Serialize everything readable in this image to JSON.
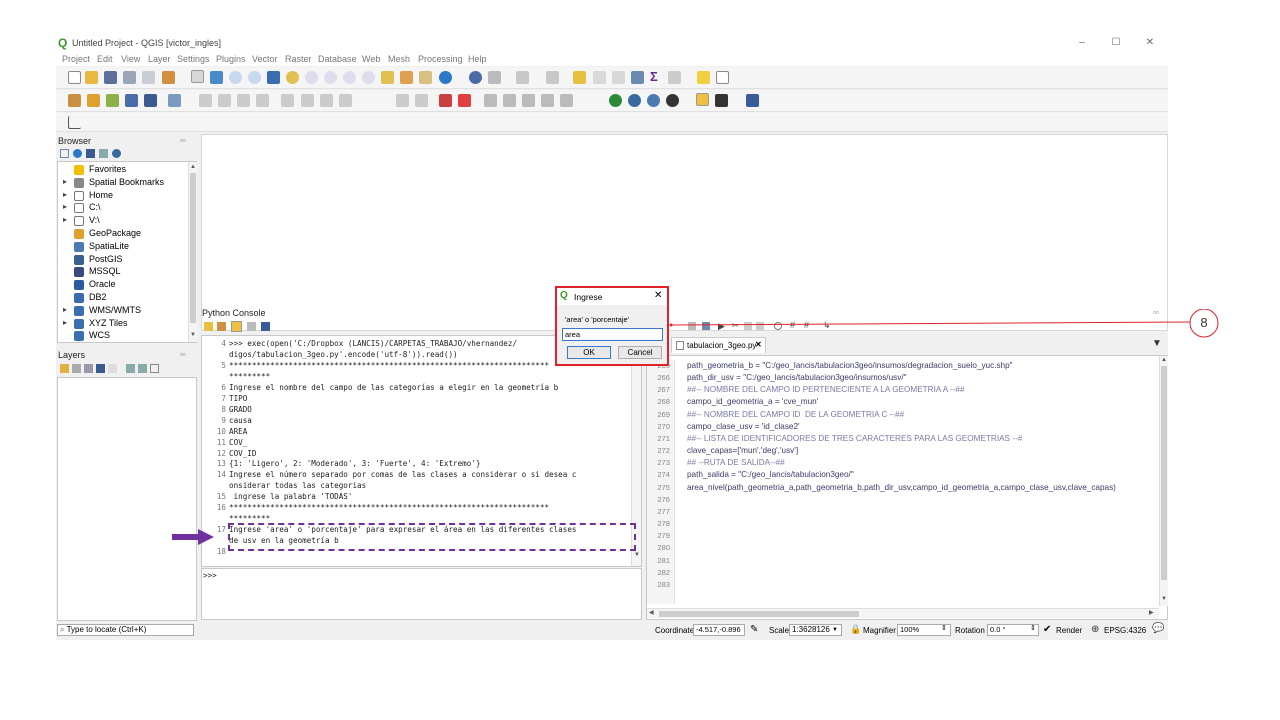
{
  "window": {
    "title": "Untitled Project - QGIS [victor_ingles]",
    "controls": {
      "minimize": "–",
      "maximize": "☐",
      "close": "✕"
    }
  },
  "menu": [
    "Project",
    "Edit",
    "View",
    "Layer",
    "Settings",
    "Plugins",
    "Vector",
    "Raster",
    "Database",
    "Web",
    "Mesh",
    "Processing",
    "Help"
  ],
  "browser": {
    "title": "Browser",
    "items": [
      {
        "label": "Favorites",
        "icon": "star-icon",
        "expand": ""
      },
      {
        "label": "Spatial Bookmarks",
        "icon": "bookmark-icon",
        "expand": "▸"
      },
      {
        "label": "Home",
        "icon": "home-icon",
        "expand": "▸"
      },
      {
        "label": "C:\\",
        "icon": "drive-icon",
        "expand": "▸"
      },
      {
        "label": "V:\\",
        "icon": "drive-icon",
        "expand": "▸"
      },
      {
        "label": "GeoPackage",
        "icon": "geopackage-icon",
        "expand": ""
      },
      {
        "label": "SpatiaLite",
        "icon": "spatialite-icon",
        "expand": ""
      },
      {
        "label": "PostGIS",
        "icon": "postgis-icon",
        "expand": ""
      },
      {
        "label": "MSSQL",
        "icon": "mssql-icon",
        "expand": ""
      },
      {
        "label": "Oracle",
        "icon": "oracle-icon",
        "expand": ""
      },
      {
        "label": "DB2",
        "icon": "db2-icon",
        "expand": ""
      },
      {
        "label": "WMS/WMTS",
        "icon": "globe-icon",
        "expand": "▸"
      },
      {
        "label": "XYZ Tiles",
        "icon": "globe-icon",
        "expand": "▸"
      },
      {
        "label": "WCS",
        "icon": "globe-icon",
        "expand": ""
      }
    ]
  },
  "layers": {
    "title": "Layers"
  },
  "console": {
    "title": "Python Console",
    "prompt": ">>>",
    "lines": [
      {
        "n": "4",
        "t": ">>> exec(open('C:/Dropbox (LANCIS)/CARPETAS_TRABAJO/vhernandez/"
      },
      {
        "n": "",
        "t": "digos/tabulacion_3geo.py'.encode('utf-8')).read())"
      },
      {
        "n": "5",
        "t": "**********************************************************************"
      },
      {
        "n": "",
        "t": "*********"
      },
      {
        "n": "6",
        "t": "Ingrese el nombre del campo de las categorías a elegir en la geometría b"
      },
      {
        "n": "7",
        "t": "TIPO"
      },
      {
        "n": "8",
        "t": "GRADO"
      },
      {
        "n": "9",
        "t": "causa"
      },
      {
        "n": "10",
        "t": "AREA"
      },
      {
        "n": "11",
        "t": "COV_"
      },
      {
        "n": "12",
        "t": "COV_ID"
      },
      {
        "n": "13",
        "t": "{1: 'Ligero', 2: 'Moderado', 3: 'Fuerte', 4: 'Extremo'}"
      },
      {
        "n": "14",
        "t": "Ingrese el número separado por comas de las clases a considerar o si desea c"
      },
      {
        "n": "",
        "t": "onsiderar todas las categorias"
      },
      {
        "n": "15",
        "t": " ingrese la palabra 'TODAS'"
      },
      {
        "n": "16",
        "t": "**********************************************************************"
      },
      {
        "n": "",
        "t": "*********"
      },
      {
        "n": "17",
        "t": "Ingrese 'area' o 'porcentaje' para expresar el área en las diferentes clases"
      },
      {
        "n": "",
        "t": "de usv en la geometría b"
      },
      {
        "n": "18",
        "t": ""
      }
    ]
  },
  "editor": {
    "tab": "tabulacion_3geo.py",
    "tab_close": "✕",
    "lines": [
      {
        "n": "265",
        "t": "path_geometria_b = \"C:/geo_lancis/tabulacion3geo/insumos/degradacion_suelo_yuc.shp\""
      },
      {
        "n": "266",
        "t": "path_dir_usv = \"C:/geo_lancis/tabulacion3geo/insumos/usv/\""
      },
      {
        "n": "267",
        "t": ""
      },
      {
        "n": "268",
        "t": "##-- NOMBRE DEL CAMPO ID PERTENECIENTE A LA GEOMETRIA A --##"
      },
      {
        "n": "269",
        "t": "campo_id_geometria_a = 'cve_mun'"
      },
      {
        "n": "270",
        "t": "##-- NOMBRE DEL CAMPO ID  DE LA GEOMETRIA C --##"
      },
      {
        "n": "271",
        "t": "campo_clase_usv = 'id_clase2'"
      },
      {
        "n": "272",
        "t": ""
      },
      {
        "n": "273",
        "t": "##-- LISTA DE IDENTIFICADORES DE TRES CARACTERES PARA LAS GEOMETRIAS --#"
      },
      {
        "n": "274",
        "t": "clave_capas=['mun','deg','usv']"
      },
      {
        "n": "275",
        "t": ""
      },
      {
        "n": "276",
        "t": "## --RUTA DE SALIDA--##"
      },
      {
        "n": "277",
        "t": "path_salida = \"C:/geo_lancis/tabulacion3geo/\""
      },
      {
        "n": "278",
        "t": ""
      },
      {
        "n": "279",
        "t": "area_nivel(path_geometria_a,path_geometria_b,path_dir_usv,campo_id_geometria_a,campo_clase_usv,clave_capas)"
      },
      {
        "n": "280",
        "t": ""
      },
      {
        "n": "281",
        "t": ""
      },
      {
        "n": "282",
        "t": ""
      },
      {
        "n": "283",
        "t": ""
      }
    ]
  },
  "dialog": {
    "title": "Ingrese",
    "close": "✕",
    "prompt": "'area' o 'porcentaje'",
    "value": "area",
    "ok": "OK",
    "cancel": "Cancel"
  },
  "callout": {
    "number": "8"
  },
  "status": {
    "locate_placeholder": "Type to locate (Ctrl+K)",
    "coordinate_label": "Coordinate",
    "coordinate_value": "-4.517,-0.896",
    "scale_label": "Scale",
    "scale_value": "1:3628126",
    "magnifier_label": "Magnifier",
    "magnifier_value": "100%",
    "rotation_label": "Rotation",
    "rotation_value": "0.0 °",
    "render_label": "Render",
    "crs": "EPSG:4326"
  },
  "colors": {
    "accent_red": "#e0232a",
    "annotation_purple": "#7030a0",
    "qgis_green": "#3a9a28"
  }
}
